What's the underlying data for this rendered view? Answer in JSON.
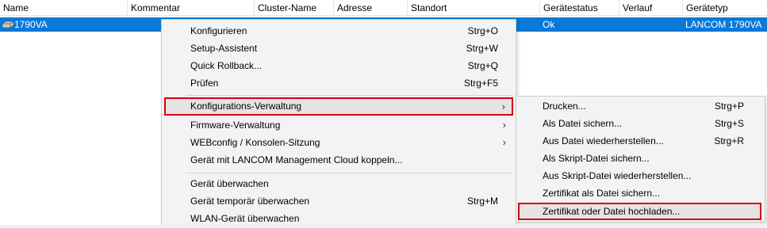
{
  "columns": [
    "Name",
    "Kommentar",
    "Cluster-Name",
    "Adresse",
    "Standort",
    "Gerätestatus",
    "Verlauf",
    "Gerätetyp"
  ],
  "selected_row": {
    "name": "1790VA",
    "status": "Ok",
    "type": "LANCOM 1790VA"
  },
  "context_menu": {
    "items": [
      {
        "label": "Konfigurieren",
        "shortcut": "Strg+O"
      },
      {
        "label": "Setup-Assistent",
        "shortcut": "Strg+W"
      },
      {
        "label": "Quick Rollback...",
        "shortcut": "Strg+Q"
      },
      {
        "label": "Prüfen",
        "shortcut": "Strg+F5"
      },
      {
        "label": "Konfigurations-Verwaltung",
        "submenu": true
      },
      {
        "label": "Firmware-Verwaltung",
        "submenu": true
      },
      {
        "label": "WEBconfig / Konsolen-Sitzung",
        "submenu": true
      },
      {
        "label": "Gerät mit LANCOM Management Cloud koppeln..."
      },
      {
        "label": "Gerät überwachen"
      },
      {
        "label": "Gerät temporär überwachen",
        "shortcut": "Strg+M"
      },
      {
        "label": "WLAN-Gerät überwachen"
      }
    ]
  },
  "submenu": {
    "items": [
      {
        "label": "Drucken...",
        "shortcut": "Strg+P"
      },
      {
        "label": "Als Datei sichern...",
        "shortcut": "Strg+S"
      },
      {
        "label": "Aus Datei wiederherstellen...",
        "shortcut": "Strg+R"
      },
      {
        "label": "Als Skript-Datei sichern..."
      },
      {
        "label": "Aus Skript-Datei wiederherstellen..."
      },
      {
        "label": "Zertifikat als Datei sichern..."
      },
      {
        "label": "Zertifikat oder Datei hochladen..."
      }
    ]
  },
  "icons": {
    "device": "router-icon",
    "submenu_arrow": "chevron-right-icon"
  },
  "colors": {
    "selection": "#0a78d7",
    "highlight_box": "#d8000c"
  }
}
